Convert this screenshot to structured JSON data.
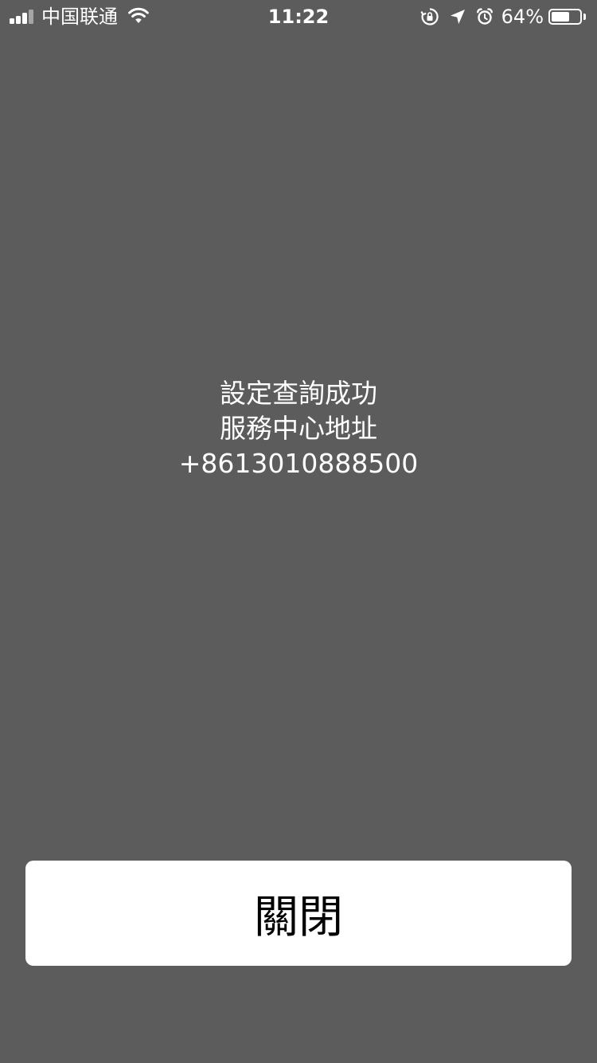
{
  "status_bar": {
    "carrier": "中国联通",
    "time": "11:22",
    "battery_percent_label": "64%",
    "battery_level": 0.64,
    "icons": [
      "signal-icon",
      "wifi-icon",
      "orientation-lock-icon",
      "location-arrow-icon",
      "alarm-icon",
      "battery-icon"
    ]
  },
  "message": {
    "line1": "設定查詢成功",
    "line2": "服務中心地址",
    "line3": "+8613010888500"
  },
  "close_button": {
    "label": "關閉"
  },
  "colors": {
    "background": "#5c5c5c",
    "text": "#ffffff",
    "button_background": "#ffffff",
    "button_text": "#000000"
  }
}
